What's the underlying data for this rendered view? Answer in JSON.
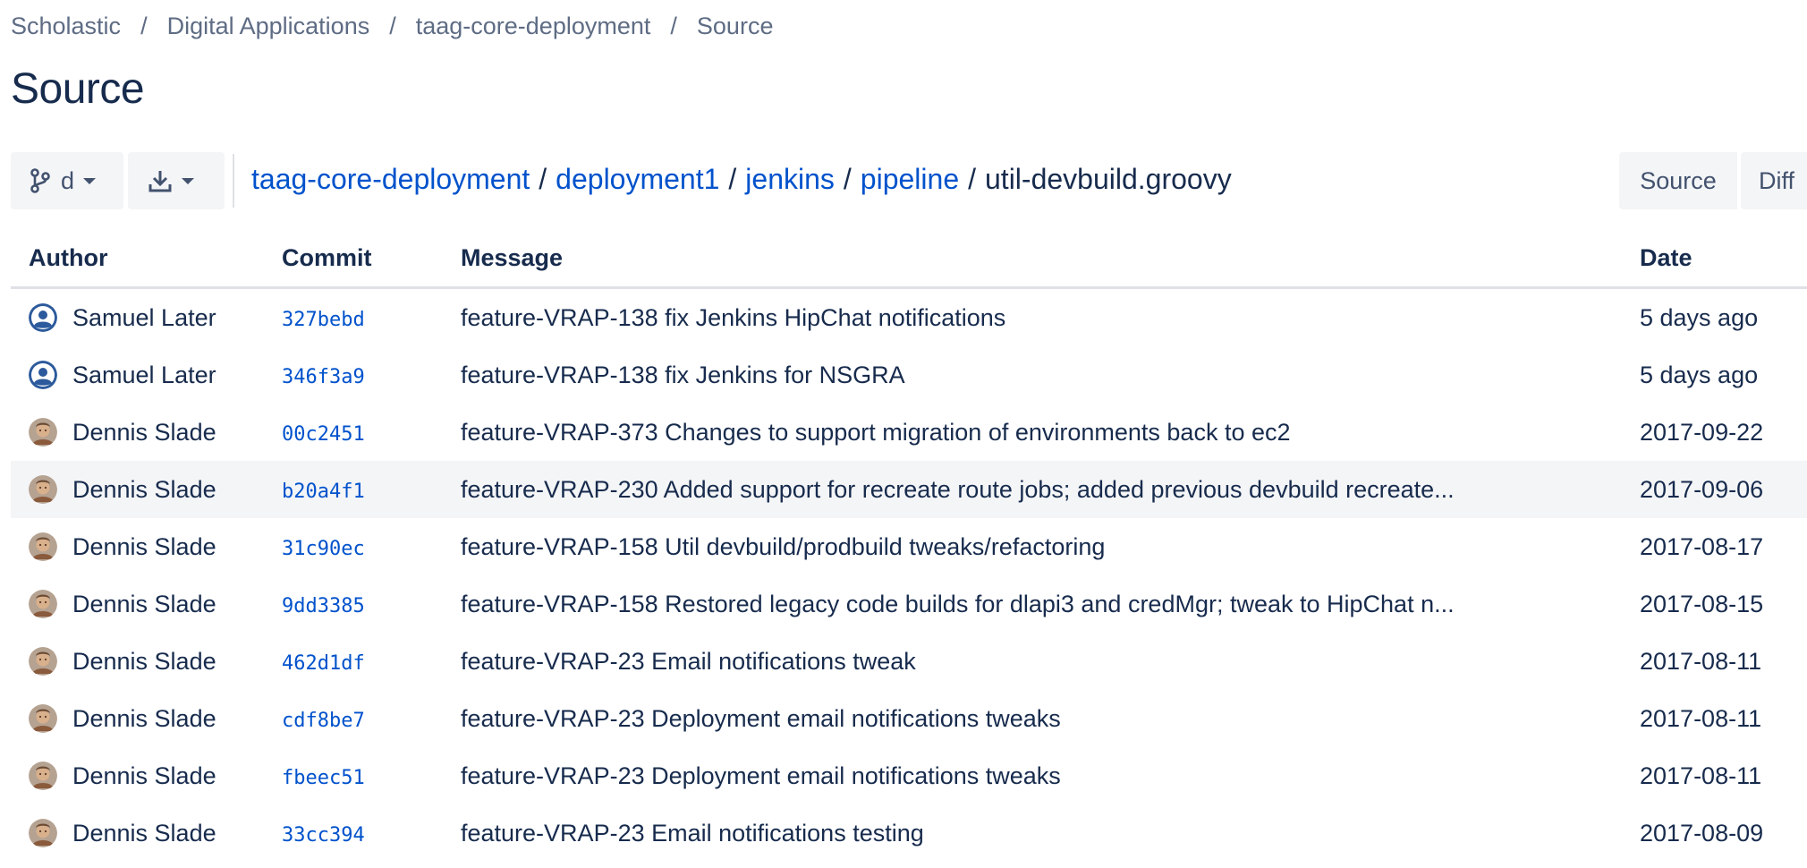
{
  "breadcrumb": [
    "Scholastic",
    "Digital Applications",
    "taag-core-deployment",
    "Source"
  ],
  "page_title": "Source",
  "toolbar": {
    "branch_label": "d",
    "path_links": [
      "taag-core-deployment",
      "deployment1",
      "jenkins",
      "pipeline"
    ],
    "file_name": "util-devbuild.groovy",
    "source_label": "Source",
    "diff_label": "Diff"
  },
  "table": {
    "headers": {
      "author": "Author",
      "commit": "Commit",
      "message": "Message",
      "date": "Date"
    },
    "rows": [
      {
        "avatar": "default-user-avatar",
        "author": "Samuel Later",
        "commit": "327bebd",
        "message": "feature-VRAP-138 fix Jenkins HipChat notifications",
        "date": "5 days ago"
      },
      {
        "avatar": "default-user-avatar",
        "author": "Samuel Later",
        "commit": "346f3a9",
        "message": "feature-VRAP-138 fix Jenkins for NSGRA",
        "date": "5 days ago"
      },
      {
        "avatar": "photo-avatar",
        "author": "Dennis Slade",
        "commit": "00c2451",
        "message": "feature-VRAP-373 Changes to support migration of environments back to ec2",
        "date": "2017-09-22"
      },
      {
        "avatar": "photo-avatar",
        "author": "Dennis Slade",
        "commit": "b20a4f1",
        "message": "feature-VRAP-230 Added support for recreate route jobs; added previous devbuild recreate...",
        "date": "2017-09-06"
      },
      {
        "avatar": "photo-avatar",
        "author": "Dennis Slade",
        "commit": "31c90ec",
        "message": "feature-VRAP-158 Util devbuild/prodbuild tweaks/refactoring",
        "date": "2017-08-17"
      },
      {
        "avatar": "photo-avatar",
        "author": "Dennis Slade",
        "commit": "9dd3385",
        "message": "feature-VRAP-158 Restored legacy code builds for dlapi3 and credMgr; tweak to HipChat n...",
        "date": "2017-08-15"
      },
      {
        "avatar": "photo-avatar",
        "author": "Dennis Slade",
        "commit": "462d1df",
        "message": "feature-VRAP-23 Email notifications tweak",
        "date": "2017-08-11"
      },
      {
        "avatar": "photo-avatar",
        "author": "Dennis Slade",
        "commit": "cdf8be7",
        "message": "feature-VRAP-23 Deployment email notifications tweaks",
        "date": "2017-08-11"
      },
      {
        "avatar": "photo-avatar",
        "author": "Dennis Slade",
        "commit": "fbeec51",
        "message": "feature-VRAP-23 Deployment email notifications tweaks",
        "date": "2017-08-11"
      },
      {
        "avatar": "photo-avatar",
        "author": "Dennis Slade",
        "commit": "33cc394",
        "message": "feature-VRAP-23 Email notifications testing",
        "date": "2017-08-09"
      }
    ]
  },
  "colors": {
    "link": "#0052cc",
    "text": "#172b4d",
    "muted": "#5e6c84",
    "button_bg": "#f4f5f7",
    "highlight_row": "#f4f5f7"
  }
}
